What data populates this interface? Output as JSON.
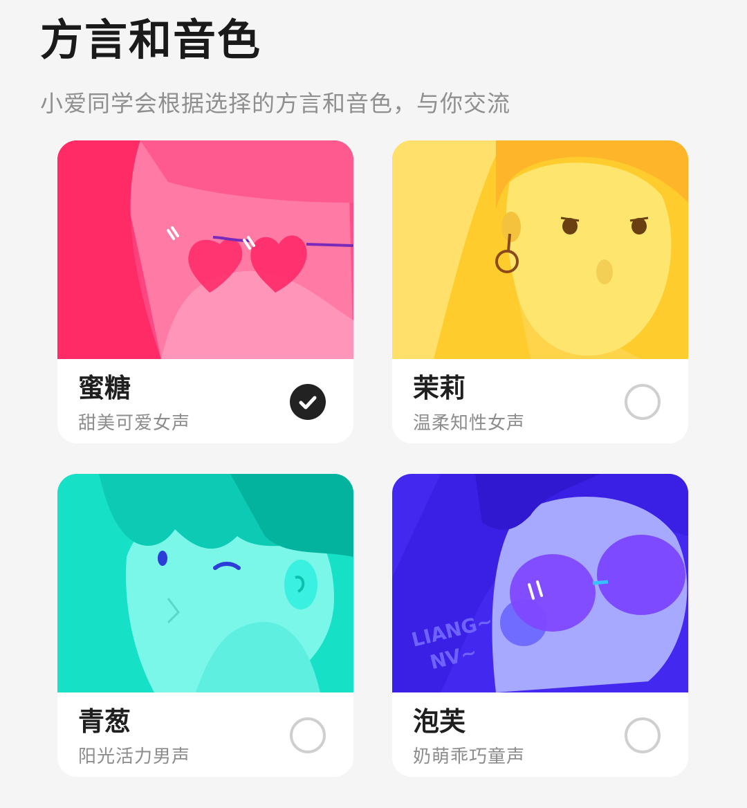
{
  "page": {
    "title": "方言和音色",
    "subtitle": "小爱同学会根据选择的方言和音色，与你交流"
  },
  "voices": [
    {
      "name": "蜜糖",
      "description": "甜美可爱女声",
      "selected": true
    },
    {
      "name": "茉莉",
      "description": "温柔知性女声",
      "selected": false
    },
    {
      "name": "青葱",
      "description": "阳光活力男声",
      "selected": false
    },
    {
      "name": "泡芙",
      "description": "奶萌乖巧童声",
      "selected": false
    }
  ],
  "art_text": {
    "line1": "LIANG~",
    "line2": "NV~"
  },
  "colors": {
    "pink": "#ff3d7f",
    "yellow": "#ffd23a",
    "teal": "#14e3cc",
    "violet": "#4b2df0",
    "selected": "#222222"
  }
}
